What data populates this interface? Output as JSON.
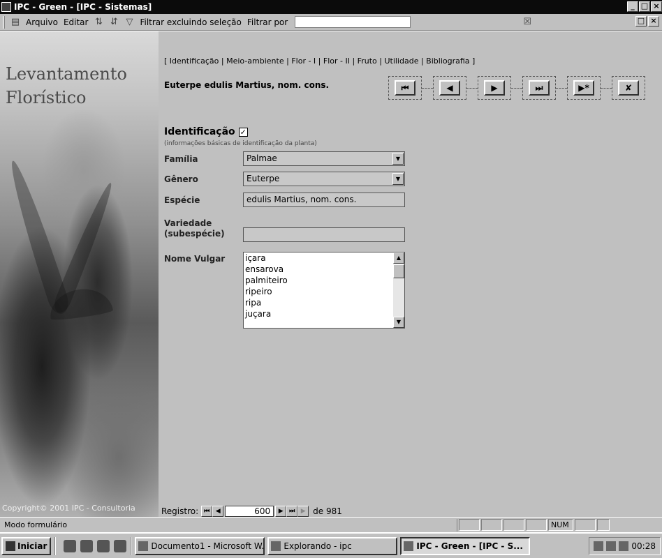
{
  "window": {
    "title": "IPC - Green - [IPC - Sistemas]",
    "controls": [
      "_",
      "□",
      "×"
    ],
    "child_controls": [
      "□",
      "×"
    ]
  },
  "menubar": {
    "arquivo": "Arquivo",
    "editar": "Editar",
    "filtrar_excluindo": "Filtrar excluindo seleção",
    "filtrar_por": "Filtrar por",
    "filter_value": ""
  },
  "left_panel": {
    "brand_line1": "Levantamento",
    "brand_line2": "Florístico",
    "copyright": "Copyright© 2001  IPC - Consultoria"
  },
  "tabs": {
    "open": "[ ",
    "close": " ]",
    "separator": " | ",
    "items": [
      "Identificação",
      "Meio-ambiente",
      "Flor - I",
      "Flor - II",
      "Fruto",
      "Utilidade",
      "Bibliografia"
    ]
  },
  "record_name": "Euterpe edulis Martius, nom. cons.",
  "nav_buttons": [
    "⏮",
    "◀",
    "▶",
    "⏭",
    "▶*",
    "✘"
  ],
  "section": {
    "title": "Identificação",
    "checked": "✓",
    "subtitle": "(informações básicas de identificação da planta)"
  },
  "fields": {
    "familia": {
      "label": "Família",
      "value": "Palmae"
    },
    "genero": {
      "label": "Gênero",
      "value": "Euterpe"
    },
    "especie": {
      "label": "Espécie",
      "value": "edulis Martius, nom. cons."
    },
    "variedade": {
      "label_line1": "Variedade",
      "label_line2": "(subespécie)",
      "value": ""
    },
    "nome_vulgar": {
      "label": "Nome Vulgar",
      "items": [
        "içara",
        "ensarova",
        "palmiteiro",
        "ripeiro",
        "ripa",
        "juçara"
      ]
    }
  },
  "record_nav": {
    "label": "Registro:",
    "current": "600",
    "of_text": "de  981"
  },
  "statusbar": {
    "message": "Modo formulário",
    "num": "NUM"
  },
  "taskbar": {
    "start": "Iniciar",
    "tasks": [
      "Documento1 - Microsoft W...",
      "Explorando - ipc",
      "IPC - Green - [IPC - S..."
    ],
    "clock": "00:28"
  }
}
